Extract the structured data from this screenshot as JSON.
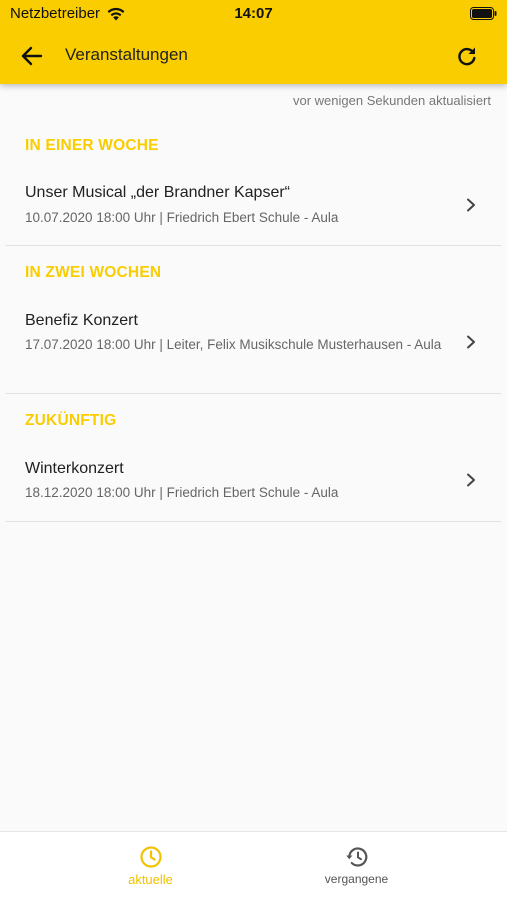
{
  "status_bar": {
    "carrier": "Netzbetreiber",
    "time": "14:07"
  },
  "app_bar": {
    "title": "Veranstaltungen",
    "back_icon": "arrow-left-icon",
    "refresh_icon": "refresh-icon"
  },
  "updated_text": "vor wenigen Sekunden aktualisiert",
  "sections": [
    {
      "header": "IN EINER WOCHE",
      "events": [
        {
          "title": "Unser Musical „der Brandner Kapser“",
          "subtitle": "10.07.2020 18:00 Uhr | Friedrich Ebert Schule - Aula"
        }
      ]
    },
    {
      "header": "IN ZWEI WOCHEN",
      "events": [
        {
          "title": "Benefiz Konzert",
          "subtitle": "17.07.2020 18:00 Uhr | Leiter, Felix Musikschule Musterhausen - Aula"
        }
      ]
    },
    {
      "header": "ZUKÜNFTIG",
      "events": [
        {
          "title": "Winterkonzert",
          "subtitle": "18.12.2020 18:00 Uhr | Friedrich Ebert Schule - Aula"
        }
      ]
    }
  ],
  "bottom_nav": {
    "items": [
      {
        "label": "aktuelle",
        "icon": "clock-icon",
        "active": true
      },
      {
        "label": "vergangene",
        "icon": "history-icon",
        "active": false
      }
    ]
  },
  "colors": {
    "accent": "#f9cd00",
    "active_nav": "#f0c200",
    "background": "#fafafa"
  }
}
